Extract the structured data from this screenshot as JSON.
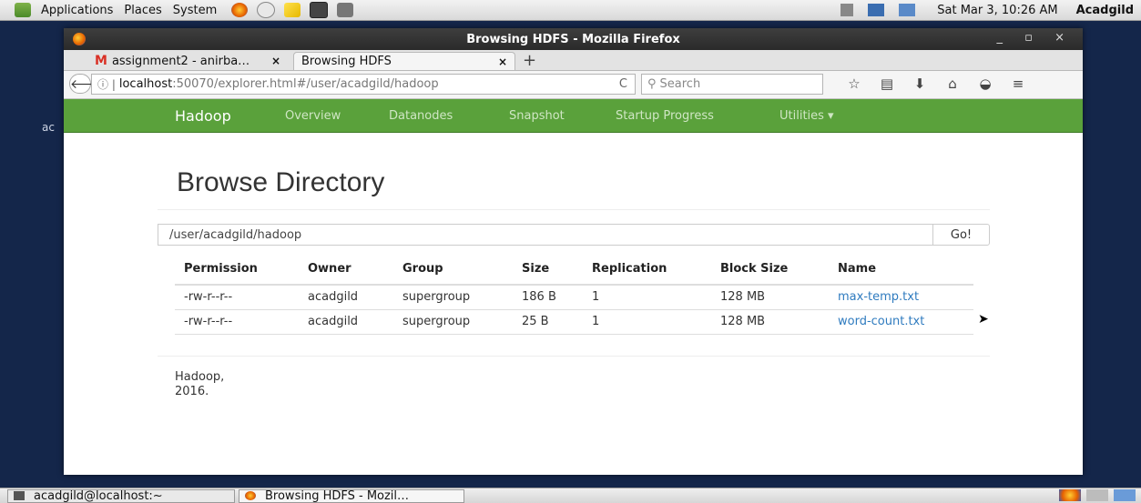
{
  "desktop_panel": {
    "menus": [
      "Applications",
      "Places",
      "System"
    ],
    "clock": "Sat Mar  3, 10:26 AM",
    "user": "Acadgild"
  },
  "desktop_text": "ac",
  "window": {
    "title": "Browsing HDFS - Mozilla Firefox",
    "controls": "_ ▫ ×"
  },
  "tabs": [
    {
      "label": "assignment2 - anirba…",
      "close": "×"
    },
    {
      "label": "Browsing HDFS",
      "close": "×"
    }
  ],
  "new_tab": "+",
  "navbar": {
    "back": "🡐",
    "url_host": "localhost",
    "url_path": ":50070/explorer.html#/user/acadgild/hadoop",
    "reload": "C",
    "search_placeholder": "Search"
  },
  "hadoop_nav": {
    "brand": "Hadoop",
    "links": [
      "Overview",
      "Datanodes",
      "Snapshot",
      "Startup Progress",
      "Utilities ▾"
    ]
  },
  "page": {
    "title": "Browse Directory",
    "directory": "/user/acadgild/hadoop",
    "go_label": "Go!",
    "table": {
      "headers": [
        "Permission",
        "Owner",
        "Group",
        "Size",
        "Replication",
        "Block Size",
        "Name"
      ],
      "rows": [
        [
          "-rw-r--r--",
          "acadgild",
          "supergroup",
          "186 B",
          "1",
          "128 MB",
          "max-temp.txt"
        ],
        [
          "-rw-r--r--",
          "acadgild",
          "supergroup",
          "25 B",
          "1",
          "128 MB",
          "word-count.txt"
        ]
      ]
    },
    "footer_line1": "Hadoop,",
    "footer_line2": "2016."
  },
  "taskbar": {
    "items": [
      "acadgild@localhost:~",
      "Browsing HDFS - Mozil…"
    ]
  },
  "colors": {
    "hadoop_green": "#5aa13b",
    "link_blue": "#2f7bbf",
    "titlebar": "#2f2f2f"
  }
}
